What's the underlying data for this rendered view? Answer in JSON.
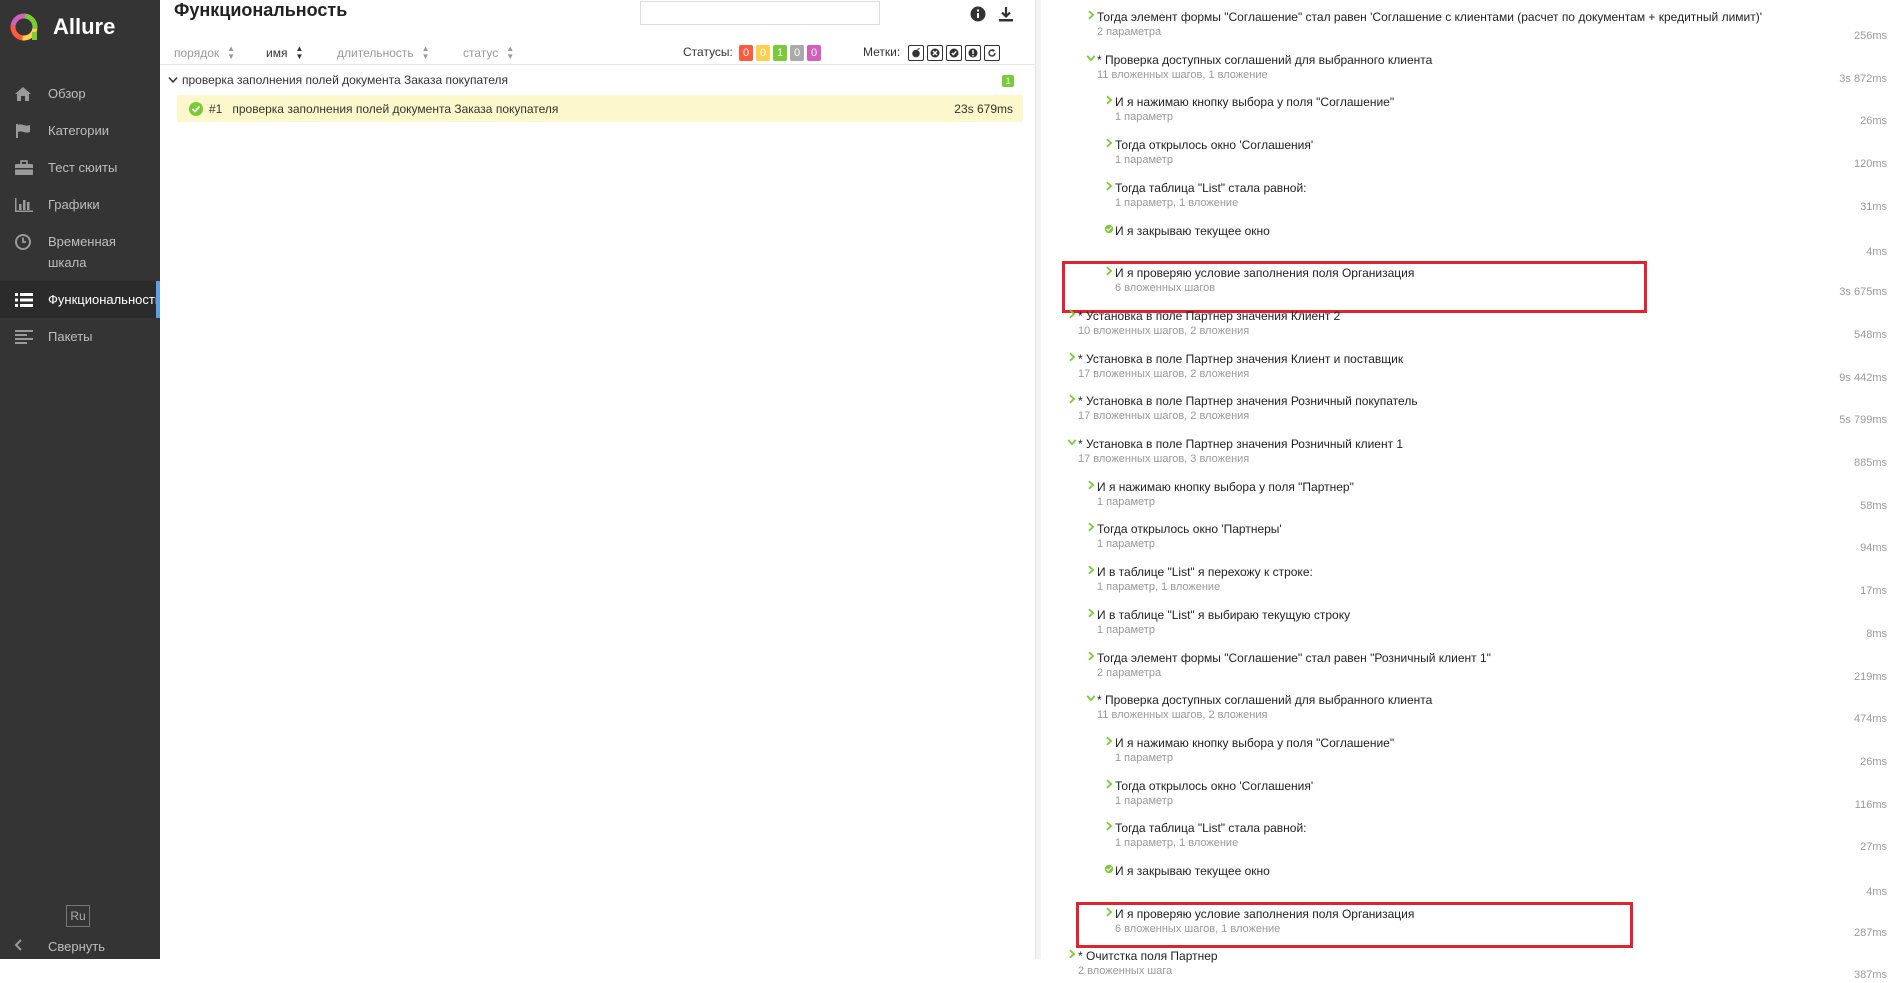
{
  "app": {
    "name": "Allure"
  },
  "colors": {
    "sidebar_bg": "#343434",
    "accent": "#5ca0e6",
    "passed": "#7acb38",
    "failed": "#fd5a3e",
    "broken": "#ffd050",
    "skipped": "#aaaaaa",
    "unknown": "#d35ebe",
    "highlight": "#e0242b",
    "selected_row": "#fcf8cb"
  },
  "sidebar": {
    "items": [
      {
        "label": "Обзор",
        "icon": "home-icon"
      },
      {
        "label": "Категории",
        "icon": "flag-icon"
      },
      {
        "label": "Тест сюиты",
        "icon": "briefcase-icon"
      },
      {
        "label": "Графики",
        "icon": "bar-chart-icon"
      },
      {
        "label": "Временная шкала",
        "icon": "clock-icon"
      },
      {
        "label": "Функциональность",
        "icon": "list-icon"
      },
      {
        "label": "Пакеты",
        "icon": "align-left-icon"
      }
    ],
    "active_index": 5,
    "language": "Ru",
    "collapse_label": "Свернуть"
  },
  "header": {
    "title": "Функциональность",
    "search_value": "",
    "search_placeholder": ""
  },
  "sort": {
    "order": "порядок",
    "name": "имя",
    "duration": "длительность",
    "status": "статус"
  },
  "statuses": {
    "label": "Статусы:",
    "counts": [
      "0",
      "0",
      "1",
      "0",
      "0"
    ]
  },
  "marks": {
    "label": "Метки:",
    "icons": [
      "flaky-icon",
      "new-failed-icon",
      "new-broken-icon",
      "new-passed-icon",
      "retries-icon"
    ]
  },
  "tree": {
    "group": {
      "label": "проверка заполнения полей документа Заказа покупателя",
      "count": "1"
    },
    "test": {
      "number": "#1",
      "name": "проверка заполнения полей документа Заказа покупателя",
      "duration": "23s 679ms"
    }
  },
  "steps": [
    {
      "level": 1,
      "expanded": false,
      "status": "passed",
      "name": "Тогда элемент формы \"Соглашение\" стал равен 'Соглашение с клиентами (расчет по документам + кредитный лимит)'",
      "sub": "2 параметра",
      "duration": "256ms"
    },
    {
      "level": 1,
      "expanded": true,
      "status": "passed",
      "name": "* Проверка доступных соглашений для выбранного клиента",
      "sub": "11 вложенных шагов, 1 вложение",
      "duration": "3s 872ms"
    },
    {
      "level": 2,
      "expanded": false,
      "status": "passed",
      "name": "И я нажимаю кнопку выбора у поля \"Соглашение\"",
      "sub": "1 параметр",
      "duration": "26ms"
    },
    {
      "level": 2,
      "expanded": false,
      "status": "passed",
      "name": "Тогда открылось окно 'Соглашения'",
      "sub": "1 параметр",
      "duration": "120ms"
    },
    {
      "level": 2,
      "expanded": false,
      "status": "passed",
      "name": "Тогда таблица \"List\" стала равной:",
      "sub": "1 параметр, 1 вложение",
      "duration": "31ms"
    },
    {
      "level": 2,
      "expanded": false,
      "status": "passed",
      "leaf": true,
      "name": "И я закрываю текущее окно",
      "sub": "",
      "duration": "4ms"
    },
    {
      "level": 2,
      "expanded": false,
      "status": "passed",
      "name": "И я проверяю условие заполнения поля Организация",
      "sub": "6 вложенных шагов",
      "duration": "3s 675ms"
    },
    {
      "level": 0,
      "expanded": false,
      "status": "passed",
      "name": "* Установка в поле Партнер значения Клиент 2",
      "sub": "10 вложенных шагов, 2 вложения",
      "duration": "548ms"
    },
    {
      "level": 0,
      "expanded": false,
      "status": "passed",
      "name": "* Установка в поле Партнер значения Клиент и поставщик",
      "sub": "17 вложенных шагов, 2 вложения",
      "duration": "9s 442ms"
    },
    {
      "level": 0,
      "expanded": false,
      "status": "passed",
      "name": "* Установка в поле Партнер значения Розничный покупатель",
      "sub": "17 вложенных шагов, 2 вложения",
      "duration": "5s 799ms"
    },
    {
      "level": 0,
      "expanded": true,
      "status": "passed",
      "name": "* Установка в поле Партнер значения Розничный клиент 1",
      "sub": "17 вложенных шагов, 3 вложения",
      "duration": "885ms"
    },
    {
      "level": 1,
      "expanded": false,
      "status": "passed",
      "name": "И я нажимаю кнопку выбора у поля \"Партнер\"",
      "sub": "1 параметр",
      "duration": "58ms"
    },
    {
      "level": 1,
      "expanded": false,
      "status": "passed",
      "name": "Тогда открылось окно 'Партнеры'",
      "sub": "1 параметр",
      "duration": "94ms"
    },
    {
      "level": 1,
      "expanded": false,
      "status": "passed",
      "name": "И в таблице \"List\" я перехожу к строке:",
      "sub": "1 параметр, 1 вложение",
      "duration": "17ms"
    },
    {
      "level": 1,
      "expanded": false,
      "status": "passed",
      "name": "И в таблице \"List\" я выбираю текущую строку",
      "sub": "1 параметр",
      "duration": "8ms"
    },
    {
      "level": 1,
      "expanded": false,
      "status": "passed",
      "name": "Тогда элемент формы \"Соглашение\" стал равен \"Розничный клиент 1\"",
      "sub": "2 параметра",
      "duration": "219ms"
    },
    {
      "level": 1,
      "expanded": true,
      "status": "passed",
      "name": "* Проверка доступных соглашений для выбранного клиента",
      "sub": "11 вложенных шагов, 2 вложения",
      "duration": "474ms"
    },
    {
      "level": 2,
      "expanded": false,
      "status": "passed",
      "name": "И я нажимаю кнопку выбора у поля \"Соглашение\"",
      "sub": "1 параметр",
      "duration": "26ms"
    },
    {
      "level": 2,
      "expanded": false,
      "status": "passed",
      "name": "Тогда открылось окно 'Соглашения'",
      "sub": "1 параметр",
      "duration": "116ms"
    },
    {
      "level": 2,
      "expanded": false,
      "status": "passed",
      "name": "Тогда таблица \"List\" стала равной:",
      "sub": "1 параметр, 1 вложение",
      "duration": "27ms"
    },
    {
      "level": 2,
      "expanded": false,
      "status": "passed",
      "leaf": true,
      "name": "И я закрываю текущее окно",
      "sub": "",
      "duration": "4ms"
    },
    {
      "level": 2,
      "expanded": false,
      "status": "passed",
      "name": "И я проверяю условие заполнения поля Организация",
      "sub": "6 вложенных шагов, 1 вложение",
      "duration": "287ms"
    },
    {
      "level": 0,
      "expanded": false,
      "status": "passed",
      "name": "* Очитстка поля Партнер",
      "sub": "2 вложенных шага",
      "duration": "387ms"
    }
  ]
}
